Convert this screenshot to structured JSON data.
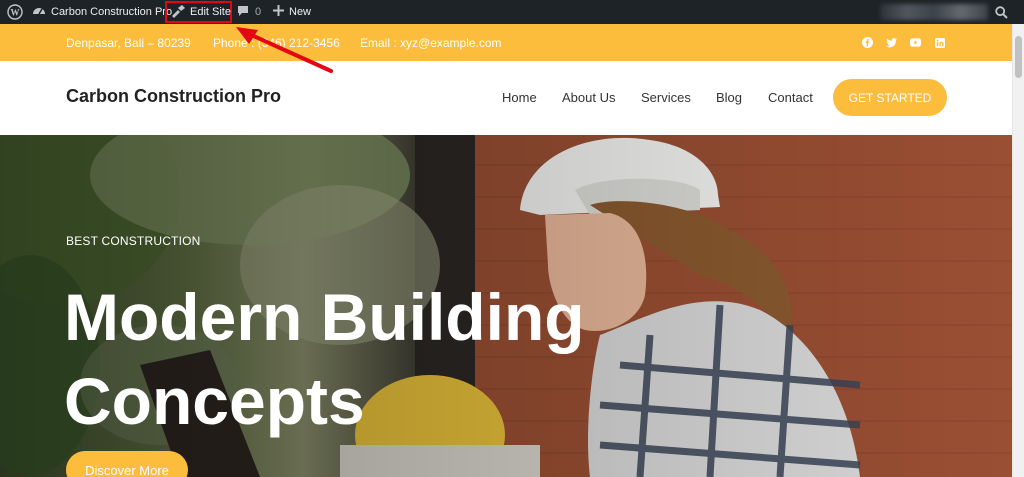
{
  "adminbar": {
    "site_name": "Carbon Construction Pro",
    "edit_site": "Edit Site",
    "comments_count": "0",
    "new_label": "New",
    "icons": [
      "wordpress-icon",
      "dashboard-icon",
      "brush-icon",
      "comment-icon",
      "plus-icon",
      "search-icon"
    ]
  },
  "topbar": {
    "address": "Denpasar, Bali – 80239",
    "phone": "Phone : (346) 212-3456",
    "email": "Email : xyz@example.com",
    "social": [
      "facebook-icon",
      "twitter-icon",
      "youtube-icon",
      "linkedin-icon"
    ]
  },
  "header": {
    "logo": "Carbon Construction Pro",
    "nav": [
      "Home",
      "About Us",
      "Services",
      "Blog",
      "Contact"
    ],
    "cta": "GET STARTED"
  },
  "hero": {
    "eyebrow": "BEST CONSTRUCTION",
    "headline_1": "Modern Building",
    "headline_2": "Concepts",
    "button": "Discover More"
  },
  "colors": {
    "accent": "#fcbd3c",
    "adminbar": "#1d2327",
    "annotation": "#e30613"
  }
}
